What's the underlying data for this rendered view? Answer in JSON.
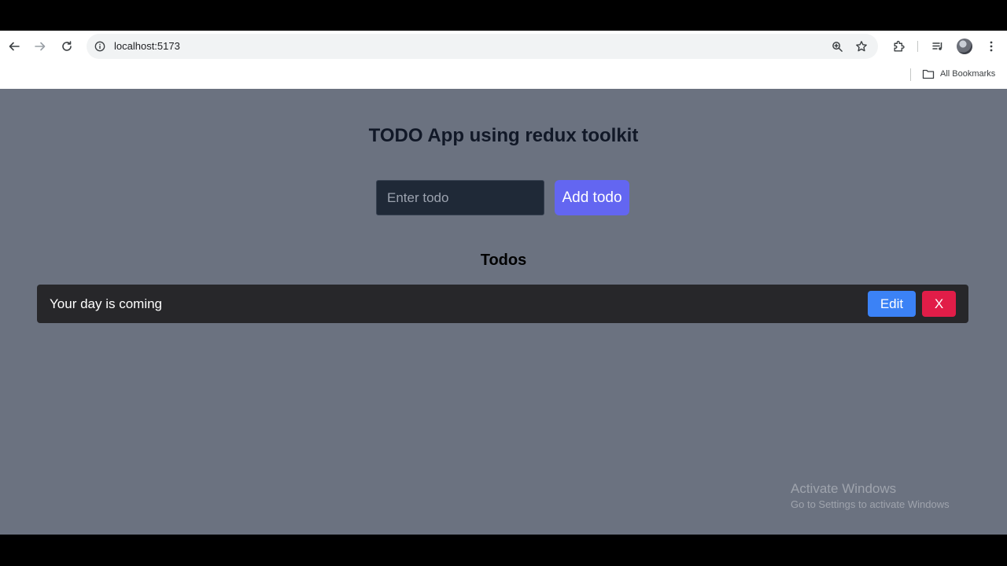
{
  "browser": {
    "url": "localhost:5173",
    "bookmarks_label": "All Bookmarks",
    "icons": {
      "back": "arrow-left-icon",
      "forward": "arrow-right-icon",
      "reload": "reload-icon",
      "site_info": "info-icon",
      "zoom": "zoom-icon",
      "bookmark": "star-icon",
      "extensions": "puzzle-icon",
      "media": "media-queue-icon",
      "menu": "kebab-menu-icon",
      "bookmarks_folder": "folder-icon"
    }
  },
  "app": {
    "title": "TODO App using redux toolkit",
    "input_placeholder": "Enter todo",
    "input_value": "",
    "add_button_label": "Add todo",
    "todos_heading": "Todos",
    "todos": [
      {
        "text": "Your day is coming",
        "edit_label": "Edit",
        "delete_label": "X"
      }
    ]
  },
  "watermark": {
    "title": "Activate Windows",
    "subtitle": "Go to Settings to activate Windows"
  },
  "colors": {
    "page_background": "#6b7280",
    "input_background": "#1f2937",
    "add_button": "#6366f1",
    "todo_item_background": "#27272a",
    "edit_button": "#3b82f6",
    "delete_button": "#e11d48"
  }
}
